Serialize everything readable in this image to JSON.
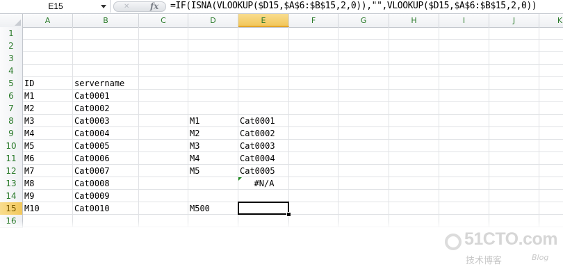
{
  "formula_bar": {
    "name_box": "E15",
    "formula": "=IF(ISNA(VLOOKUP($D15,$A$6:$B$15,2,0)),\"\",VLOOKUP($D15,$A$6:$B$15,2,0))"
  },
  "columns": [
    "A",
    "B",
    "C",
    "D",
    "E",
    "F",
    "G",
    "H",
    "I",
    "J",
    "K"
  ],
  "selected_column": "E",
  "rows": [
    "1",
    "2",
    "3",
    "4",
    "5",
    "6",
    "7",
    "8",
    "9",
    "10",
    "11",
    "12",
    "13",
    "14",
    "15",
    "16"
  ],
  "selected_row": "15",
  "cells": {
    "A5": "ID",
    "B5": "servername",
    "A6": "M1",
    "B6": "Cat0001",
    "A7": "M2",
    "B7": "Cat0002",
    "A8": "M3",
    "B8": "Cat0003",
    "D8": "M1",
    "E8": "Cat0001",
    "A9": "M4",
    "B9": "Cat0004",
    "D9": "M2",
    "E9": "Cat0002",
    "A10": "M5",
    "B10": "Cat0005",
    "D10": "M3",
    "E10": "Cat0003",
    "A11": "M6",
    "B11": "Cat0006",
    "D11": "M4",
    "E11": "Cat0004",
    "A12": "M7",
    "B12": "Cat0007",
    "D12": "M5",
    "E12": "Cat0005",
    "A13": "M8",
    "B13": "Cat0008",
    "E13": "#N/A",
    "A14": "M9",
    "B14": "Cat0009",
    "A15": "M10",
    "B15": "Cat0010",
    "D15": "M500"
  },
  "watermark": {
    "main": "51CTO.com",
    "sub": "技术博客",
    "blog": "Blog"
  },
  "colors": {
    "header_text": "#2a7a2a",
    "selected_header": "#f2c75b",
    "gridline": "#e0e2e5",
    "error_triangle": "#1f8a1f"
  }
}
